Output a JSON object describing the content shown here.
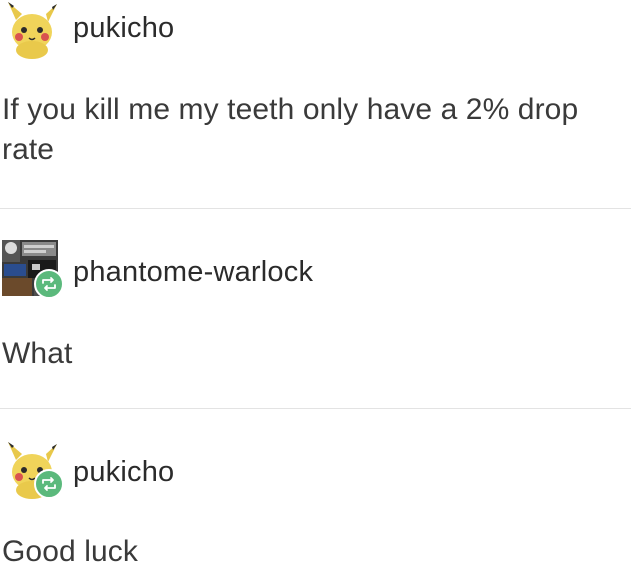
{
  "posts": [
    {
      "username": "pukicho",
      "text": "If you kill me my teeth only have a 2% drop rate",
      "avatar": "pikachu-plush-icon",
      "reblogged": false
    },
    {
      "username": "phantome-warlock",
      "text": "What",
      "avatar": "collage-avatar-icon",
      "reblogged": true
    },
    {
      "username": "pukicho",
      "text": "Good luck",
      "avatar": "pikachu-plush-icon",
      "reblogged": true
    }
  ],
  "colors": {
    "reblog_badge": "#5bb97c",
    "divider": "#e3e3e3",
    "text": "#363636"
  }
}
